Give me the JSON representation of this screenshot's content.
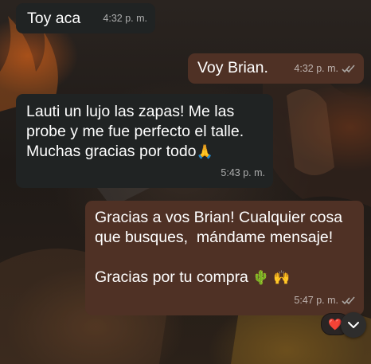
{
  "messages": [
    {
      "direction": "incoming",
      "text": "Toy aca",
      "time": "4:32 p. m."
    },
    {
      "direction": "outgoing",
      "text": "Voy Brian.",
      "time": "4:32 p. m.",
      "status": "read"
    },
    {
      "direction": "incoming",
      "text": "Lauti un lujo las zapas! Me las\nprobe y me fue perfecto el talle.\nMuchas gracias por todo",
      "emoji": "🙏",
      "time": "5:43 p. m."
    },
    {
      "direction": "outgoing",
      "text": "Gracias a vos Brian! Cualquier cosa\nque busques,  mándame mensaje!\n\nGracias por tu compra",
      "emoji": "🌵 🙌",
      "time": "5:47 p. m.",
      "status": "read",
      "reaction": "❤️"
    }
  ],
  "colors": {
    "incoming_bubble": "#202323",
    "outgoing_bubble": "#4f3125",
    "tick": "#a9a4a0"
  },
  "icons": [
    "double-check-icon",
    "heart-reaction-icon",
    "chevron-down-icon"
  ]
}
